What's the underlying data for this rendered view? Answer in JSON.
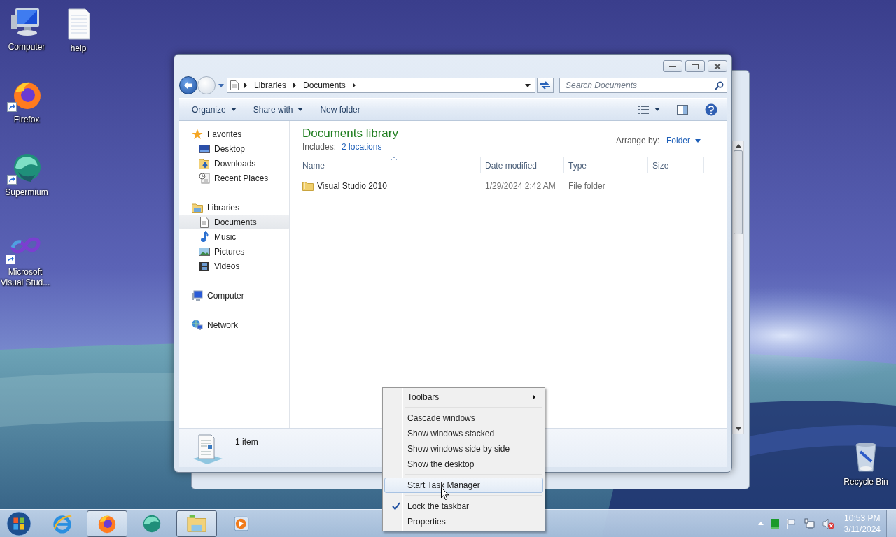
{
  "desktop_icons": [
    {
      "label": "Computer",
      "shortcut": false
    },
    {
      "label": "help",
      "shortcut": false
    },
    {
      "label": "Firefox",
      "shortcut": true
    },
    {
      "label": "Supermium",
      "shortcut": true
    },
    {
      "label": "Microsoft Visual Stud...",
      "shortcut": true
    },
    {
      "label": "Recycle Bin",
      "shortcut": false
    }
  ],
  "explorer": {
    "breadcrumb": [
      "Libraries",
      "Documents"
    ],
    "search": {
      "placeholder": "Search Documents"
    },
    "toolbar": [
      {
        "label": "Organize",
        "dropdown": true
      },
      {
        "label": "Share with",
        "dropdown": true
      },
      {
        "label": "New folder",
        "dropdown": false
      }
    ],
    "nav": [
      {
        "label": "Favorites",
        "selected": false,
        "children": [
          {
            "label": "Desktop",
            "selected": false
          },
          {
            "label": "Downloads",
            "selected": false
          },
          {
            "label": "Recent Places",
            "selected": false
          }
        ]
      },
      {
        "label": "Libraries",
        "selected": false,
        "children": [
          {
            "label": "Documents",
            "selected": true
          },
          {
            "label": "Music",
            "selected": false
          },
          {
            "label": "Pictures",
            "selected": false
          },
          {
            "label": "Videos",
            "selected": false
          }
        ]
      },
      {
        "label": "Computer",
        "selected": false
      },
      {
        "label": "Network",
        "selected": false
      }
    ],
    "library": {
      "title": "Documents library",
      "includes_label": "Includes:",
      "includes_link": "2 locations",
      "arrange_label": "Arrange by:",
      "arrange_value": "Folder"
    },
    "columns": [
      {
        "label": "Name",
        "sorted": true
      },
      {
        "label": "Date modified",
        "sorted": false
      },
      {
        "label": "Type",
        "sorted": false
      },
      {
        "label": "Size",
        "sorted": false
      }
    ],
    "rows": [
      {
        "name": "Visual Studio 2010",
        "date": "1/29/2024 2:42 AM",
        "type": "File folder"
      }
    ],
    "details": {
      "count": "1 item"
    }
  },
  "context_menu": [
    {
      "kind": "item",
      "label": "Toolbars",
      "submenu": true,
      "checked": false,
      "selected": false
    },
    {
      "kind": "separator"
    },
    {
      "kind": "item",
      "label": "Cascade windows",
      "submenu": false,
      "checked": false,
      "selected": false
    },
    {
      "kind": "item",
      "label": "Show windows stacked",
      "submenu": false,
      "checked": false,
      "selected": false
    },
    {
      "kind": "item",
      "label": "Show windows side by side",
      "submenu": false,
      "checked": false,
      "selected": false
    },
    {
      "kind": "item",
      "label": "Show the desktop",
      "submenu": false,
      "checked": false,
      "selected": false
    },
    {
      "kind": "separator"
    },
    {
      "kind": "item",
      "label": "Start Task Manager",
      "submenu": false,
      "checked": false,
      "selected": true
    },
    {
      "kind": "separator"
    },
    {
      "kind": "item",
      "label": "Lock the taskbar",
      "submenu": false,
      "checked": true,
      "selected": false
    },
    {
      "kind": "item",
      "label": "Properties",
      "submenu": false,
      "checked": false,
      "selected": false
    }
  ],
  "taskbar": {
    "apps": [
      {
        "active": false
      },
      {
        "active": true
      },
      {
        "active": false
      },
      {
        "active": true
      },
      {
        "active": false
      }
    ],
    "clock": {
      "time": "10:53 PM",
      "date": "3/11/2024"
    }
  }
}
